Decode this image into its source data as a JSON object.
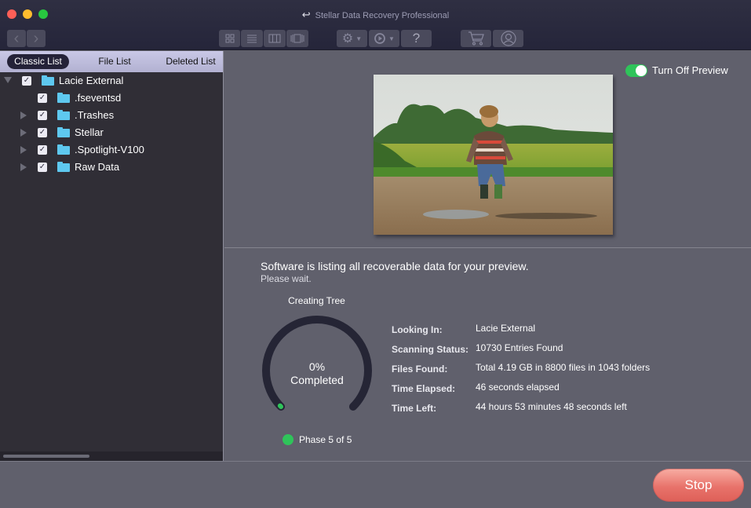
{
  "window": {
    "title": "Stellar Data Recovery Professional",
    "title_icon": "back-arrow-icon"
  },
  "toolbar": {
    "nav": [
      {
        "name": "back",
        "icon": "chevron-left-icon",
        "glyph": "‹"
      },
      {
        "name": "forward",
        "icon": "chevron-right-icon",
        "glyph": "›"
      }
    ],
    "view_modes": [
      "grid-view-icon",
      "list-view-icon",
      "column-view-icon",
      "cover-flow-icon"
    ],
    "settings_icon": "gear-icon",
    "history_icon": "resume-recovery-icon",
    "help_label": "?",
    "cart_icon": "cart-icon",
    "account_icon": "user-icon"
  },
  "sidebar": {
    "tabs": [
      {
        "label": "Classic List",
        "active": true
      },
      {
        "label": "File List",
        "active": false
      },
      {
        "label": "Deleted List",
        "active": false
      }
    ],
    "tree": [
      {
        "label": "Lacie External",
        "level": 0,
        "expanded": true,
        "has_children": true,
        "checked": true
      },
      {
        "label": ".fseventsd",
        "level": 1,
        "expanded": false,
        "has_children": false,
        "checked": true
      },
      {
        "label": ".Trashes",
        "level": 1,
        "expanded": false,
        "has_children": true,
        "checked": true
      },
      {
        "label": "Stellar",
        "level": 1,
        "expanded": false,
        "has_children": true,
        "checked": true
      },
      {
        "label": ".Spotlight-V100",
        "level": 1,
        "expanded": false,
        "has_children": true,
        "checked": true
      },
      {
        "label": "Raw Data",
        "level": 1,
        "expanded": false,
        "has_children": true,
        "checked": true
      }
    ]
  },
  "preview": {
    "toggle_label": "Turn Off Preview",
    "toggle_on": true,
    "image_description": "Child jumping into a puddle on a dirt road in front of a green field"
  },
  "scan": {
    "message": "Software is listing all recoverable data for your preview.",
    "sub_message": "Please wait.",
    "phase_title": "Creating Tree",
    "percent_label": "0%",
    "completed_label": "Completed",
    "progress_fraction": 0.0,
    "phase_label": "Phase 5 of 5",
    "details": [
      {
        "key": "Looking In:",
        "value": "Lacie External"
      },
      {
        "key": "Scanning Status:",
        "value": "10730  Entries Found"
      },
      {
        "key": "Files Found:",
        "value": "Total 4.19 GB in 8800 files in 1043 folders"
      },
      {
        "key": "Time Elapsed:",
        "value": "46 seconds elapsed"
      },
      {
        "key": "Time Left:",
        "value": "44 hours 53 minutes 48 seconds left"
      }
    ]
  },
  "footer": {
    "stop_label": "Stop"
  },
  "colors": {
    "accent_green": "#2fc45a",
    "stop_red": "#e8736b",
    "folder_blue": "#5ec8ef"
  }
}
